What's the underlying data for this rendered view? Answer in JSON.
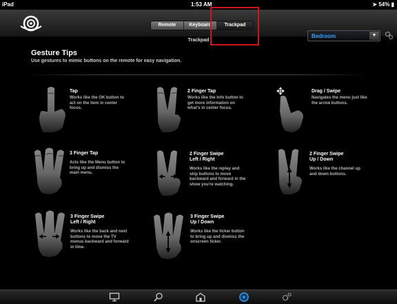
{
  "status": {
    "device": "iPad",
    "time": "1:53 AM",
    "battery": "54%"
  },
  "nav": {
    "tabs": [
      {
        "label": "Remote"
      },
      {
        "label": "Keyboard"
      },
      {
        "label": "Trackpad"
      }
    ],
    "room": "Bedroom",
    "subtitle": "Trackpad"
  },
  "tips": {
    "title": "Gesture Tips",
    "desc": "Use gestures to mimic buttons on the remote for easy navigation."
  },
  "gestures": [
    {
      "title": "Tap",
      "desc": "Works like the OK button to act on the item in center focus."
    },
    {
      "title": "2 Finger Tap",
      "desc": "Works like the Info button to get more information on what's in center focus."
    },
    {
      "title": "Drag / Swipe",
      "desc": "Navigates the menu just like the arrow buttons."
    },
    {
      "title": "3 Finger Tap",
      "desc": "Acts like the Menu button to bring up and dismiss the main menu."
    },
    {
      "title": "2 Finger Swipe\nLeft / Right",
      "desc": "Works like the replay and skip buttons to move backward and forward in the show you're watching."
    },
    {
      "title": "2 Finger Swipe\nUp / Down",
      "desc": "Works like the channel up and down buttons."
    },
    {
      "title": "3 Finger Swipe\nLeft / Right",
      "desc": "Works like the back and next buttons to move the TV menus backward and forward in time."
    },
    {
      "title": "3 Finger Swipe\nUp / Down",
      "desc": "Works like the ticker button to bring up and dismiss the onscreen ticker."
    }
  ],
  "toolbar_icons": [
    "tv-icon",
    "search-icon",
    "home-icon",
    "play-icon",
    "settings-icon"
  ],
  "colors": {
    "accent": "#3aa1ff",
    "highlight": "#d0161b"
  }
}
